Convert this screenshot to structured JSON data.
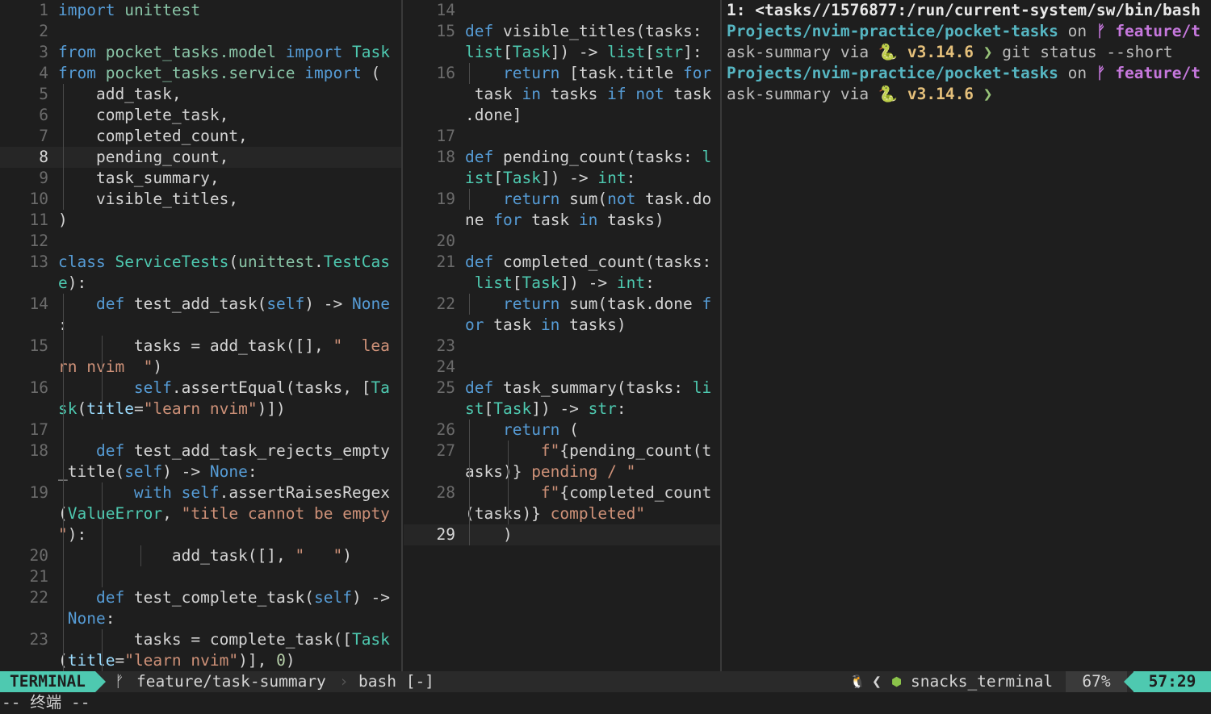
{
  "left_pane": {
    "lines": [
      {
        "n": "1",
        "code": [
          [
            "kw",
            "import"
          ],
          [
            "plain",
            " "
          ],
          [
            "mod",
            "unittest"
          ]
        ]
      },
      {
        "n": "2",
        "code": []
      },
      {
        "n": "3",
        "code": [
          [
            "kw",
            "from"
          ],
          [
            "plain",
            " "
          ],
          [
            "mod",
            "pocket_tasks.model"
          ],
          [
            "plain",
            " "
          ],
          [
            "kw",
            "import"
          ],
          [
            "plain",
            " "
          ],
          [
            "ty",
            "Task"
          ]
        ]
      },
      {
        "n": "4",
        "code": [
          [
            "kw",
            "from"
          ],
          [
            "plain",
            " "
          ],
          [
            "mod",
            "pocket_tasks.service"
          ],
          [
            "plain",
            " "
          ],
          [
            "kw",
            "import"
          ],
          [
            "plain",
            " ("
          ]
        ]
      },
      {
        "n": "5",
        "code": [
          [
            "plain",
            "    add_task,"
          ]
        ]
      },
      {
        "n": "6",
        "code": [
          [
            "plain",
            "    complete_task,"
          ]
        ]
      },
      {
        "n": "7",
        "code": [
          [
            "plain",
            "    completed_count,"
          ]
        ]
      },
      {
        "n": "8",
        "cur": true,
        "code": [
          [
            "plain",
            "    pending_count,"
          ]
        ]
      },
      {
        "n": "9",
        "code": [
          [
            "plain",
            "    task_summary,"
          ]
        ]
      },
      {
        "n": "10",
        "code": [
          [
            "plain",
            "    visible_titles,"
          ]
        ]
      },
      {
        "n": "11",
        "code": [
          [
            "plain",
            ")"
          ]
        ]
      },
      {
        "n": "12",
        "code": []
      },
      {
        "n": "13",
        "code": [
          [
            "kw",
            "class"
          ],
          [
            "plain",
            " "
          ],
          [
            "ty",
            "ServiceTests"
          ],
          [
            "plain",
            "("
          ],
          [
            "mod",
            "unittest"
          ],
          [
            "plain",
            "."
          ],
          [
            "ty",
            "TestCas"
          ]
        ]
      },
      {
        "n": "",
        "code": [
          [
            "ty",
            "e"
          ],
          [
            "plain",
            "):"
          ]
        ]
      },
      {
        "n": "14",
        "code": [
          [
            "plain",
            "    "
          ],
          [
            "kw",
            "def"
          ],
          [
            "plain",
            " test_add_task("
          ],
          [
            "slf",
            "self"
          ],
          [
            "plain",
            ") -> "
          ],
          [
            "kw",
            "None"
          ]
        ]
      },
      {
        "n": "",
        "code": [
          [
            "plain",
            ":"
          ]
        ]
      },
      {
        "n": "15",
        "code": [
          [
            "plain",
            "        tasks = add_task([], "
          ],
          [
            "str",
            "\"  lea"
          ]
        ]
      },
      {
        "n": "",
        "code": [
          [
            "str",
            "rn nvim  \""
          ],
          [
            "plain",
            ")"
          ]
        ]
      },
      {
        "n": "16",
        "code": [
          [
            "plain",
            "        "
          ],
          [
            "slf",
            "self"
          ],
          [
            "plain",
            ".assertEqual(tasks, ["
          ],
          [
            "ty",
            "Ta"
          ]
        ]
      },
      {
        "n": "",
        "code": [
          [
            "ty",
            "sk"
          ],
          [
            "plain",
            "("
          ],
          [
            "par",
            "title"
          ],
          [
            "plain",
            "="
          ],
          [
            "str",
            "\"learn nvim\""
          ],
          [
            "plain",
            ")])"
          ]
        ]
      },
      {
        "n": "17",
        "code": []
      },
      {
        "n": "18",
        "code": [
          [
            "plain",
            "    "
          ],
          [
            "kw",
            "def"
          ],
          [
            "plain",
            " test_add_task_rejects_empty"
          ]
        ]
      },
      {
        "n": "",
        "code": [
          [
            "plain",
            "_title("
          ],
          [
            "slf",
            "self"
          ],
          [
            "plain",
            ") -> "
          ],
          [
            "kw",
            "None"
          ],
          [
            "plain",
            ":"
          ]
        ]
      },
      {
        "n": "19",
        "code": [
          [
            "plain",
            "        "
          ],
          [
            "kw",
            "with"
          ],
          [
            "plain",
            " "
          ],
          [
            "slf",
            "self"
          ],
          [
            "plain",
            ".assertRaisesRegex"
          ]
        ]
      },
      {
        "n": "",
        "code": [
          [
            "plain",
            "("
          ],
          [
            "ty",
            "ValueError"
          ],
          [
            "plain",
            ", "
          ],
          [
            "str",
            "\"title cannot be empty"
          ]
        ]
      },
      {
        "n": "",
        "code": [
          [
            "str",
            "\""
          ],
          [
            "plain",
            "):"
          ]
        ]
      },
      {
        "n": "20",
        "code": [
          [
            "plain",
            "            add_task([], "
          ],
          [
            "str",
            "\"   \""
          ],
          [
            "plain",
            ")"
          ]
        ]
      },
      {
        "n": "21",
        "code": []
      },
      {
        "n": "22",
        "code": [
          [
            "plain",
            "    "
          ],
          [
            "kw",
            "def"
          ],
          [
            "plain",
            " test_complete_task("
          ],
          [
            "slf",
            "self"
          ],
          [
            "plain",
            ") ->"
          ]
        ]
      },
      {
        "n": "",
        "code": [
          [
            "plain",
            " "
          ],
          [
            "kw",
            "None"
          ],
          [
            "plain",
            ":"
          ]
        ]
      },
      {
        "n": "23",
        "code": [
          [
            "plain",
            "        tasks = complete_task(["
          ],
          [
            "ty",
            "Task"
          ]
        ]
      },
      {
        "n": "",
        "code": [
          [
            "plain",
            "("
          ],
          [
            "par",
            "title"
          ],
          [
            "plain",
            "="
          ],
          [
            "str",
            "\"learn nvim\""
          ],
          [
            "plain",
            ")], "
          ],
          [
            "num",
            "0"
          ],
          [
            "plain",
            ")"
          ]
        ]
      }
    ]
  },
  "mid_pane": {
    "lines": [
      {
        "n": "14",
        "code": []
      },
      {
        "n": "15",
        "code": [
          [
            "kw",
            "def"
          ],
          [
            "plain",
            " visible_titles(tasks:"
          ]
        ]
      },
      {
        "n": "",
        "code": [
          [
            "ty",
            "list"
          ],
          [
            "plain",
            "["
          ],
          [
            "ty",
            "Task"
          ],
          [
            "plain",
            "]) -> "
          ],
          [
            "ty",
            "list"
          ],
          [
            "plain",
            "["
          ],
          [
            "ty",
            "str"
          ],
          [
            "plain",
            "]:"
          ]
        ]
      },
      {
        "n": "16",
        "code": [
          [
            "plain",
            "    "
          ],
          [
            "kw",
            "return"
          ],
          [
            "plain",
            " [task.title "
          ],
          [
            "kw",
            "for"
          ]
        ]
      },
      {
        "n": "",
        "code": [
          [
            "plain",
            " task "
          ],
          [
            "kw",
            "in"
          ],
          [
            "plain",
            " tasks "
          ],
          [
            "kw",
            "if"
          ],
          [
            "plain",
            " "
          ],
          [
            "kw",
            "not"
          ],
          [
            "plain",
            " task"
          ]
        ]
      },
      {
        "n": "",
        "code": [
          [
            "plain",
            ".done]"
          ]
        ]
      },
      {
        "n": "17",
        "code": []
      },
      {
        "n": "18",
        "code": [
          [
            "kw",
            "def"
          ],
          [
            "plain",
            " pending_count(tasks: "
          ],
          [
            "ty",
            "l"
          ]
        ]
      },
      {
        "n": "",
        "code": [
          [
            "ty",
            "ist"
          ],
          [
            "plain",
            "["
          ],
          [
            "ty",
            "Task"
          ],
          [
            "plain",
            "]) -> "
          ],
          [
            "ty",
            "int"
          ],
          [
            "plain",
            ":"
          ]
        ]
      },
      {
        "n": "19",
        "code": [
          [
            "plain",
            "    "
          ],
          [
            "kw",
            "return"
          ],
          [
            "plain",
            " sum("
          ],
          [
            "kw",
            "not"
          ],
          [
            "plain",
            " task.do"
          ]
        ]
      },
      {
        "n": "",
        "code": [
          [
            "plain",
            "ne "
          ],
          [
            "kw",
            "for"
          ],
          [
            "plain",
            " task "
          ],
          [
            "kw",
            "in"
          ],
          [
            "plain",
            " tasks)"
          ]
        ]
      },
      {
        "n": "20",
        "code": []
      },
      {
        "n": "21",
        "code": [
          [
            "kw",
            "def"
          ],
          [
            "plain",
            " completed_count(tasks:"
          ]
        ]
      },
      {
        "n": "",
        "code": [
          [
            "plain",
            " "
          ],
          [
            "ty",
            "list"
          ],
          [
            "plain",
            "["
          ],
          [
            "ty",
            "Task"
          ],
          [
            "plain",
            "]) -> "
          ],
          [
            "ty",
            "int"
          ],
          [
            "plain",
            ":"
          ]
        ]
      },
      {
        "n": "22",
        "code": [
          [
            "plain",
            "    "
          ],
          [
            "kw",
            "return"
          ],
          [
            "plain",
            " sum(task.done "
          ],
          [
            "kw",
            "f"
          ]
        ]
      },
      {
        "n": "",
        "code": [
          [
            "kw",
            "or"
          ],
          [
            "plain",
            " task "
          ],
          [
            "kw",
            "in"
          ],
          [
            "plain",
            " tasks)"
          ]
        ]
      },
      {
        "n": "23",
        "code": []
      },
      {
        "n": "24",
        "code": []
      },
      {
        "n": "25",
        "code": [
          [
            "kw",
            "def"
          ],
          [
            "plain",
            " task_summary(tasks: "
          ],
          [
            "ty",
            "li"
          ]
        ]
      },
      {
        "n": "",
        "code": [
          [
            "ty",
            "st"
          ],
          [
            "plain",
            "["
          ],
          [
            "ty",
            "Task"
          ],
          [
            "plain",
            "]) -> "
          ],
          [
            "ty",
            "str"
          ],
          [
            "plain",
            ":"
          ]
        ]
      },
      {
        "n": "26",
        "code": [
          [
            "plain",
            "    "
          ],
          [
            "kw",
            "return"
          ],
          [
            "plain",
            " ("
          ]
        ]
      },
      {
        "n": "27",
        "code": [
          [
            "plain",
            "        "
          ],
          [
            "str",
            "f\""
          ],
          [
            "plain",
            "{pending_count(t"
          ]
        ]
      },
      {
        "n": "",
        "code": [
          [
            "plain",
            "asks)}"
          ],
          [
            "str",
            " pending / \""
          ]
        ]
      },
      {
        "n": "28",
        "code": [
          [
            "plain",
            "        "
          ],
          [
            "str",
            "f\""
          ],
          [
            "plain",
            "{completed_count"
          ]
        ]
      },
      {
        "n": "",
        "code": [
          [
            "plain",
            "(tasks)}"
          ],
          [
            "str",
            " completed\""
          ]
        ]
      },
      {
        "n": "29",
        "cur": true,
        "code": [
          [
            "plain",
            "    )"
          ]
        ]
      }
    ]
  },
  "terminal": {
    "lines": [
      [
        [
          "t-white",
          "1: <tasks//1576877:/run/current-system/sw/bin/bash"
        ]
      ],
      [
        [
          "t-cyan",
          "Projects/nvim-practice/pocket-tasks"
        ],
        [
          "t-gray",
          " on "
        ],
        [
          "t-pink",
          "ᚠ feature/t"
        ]
      ],
      [
        [
          "t-gray",
          "ask-summary via "
        ],
        [
          "t-yellow",
          "🐍 v3.14.6"
        ],
        [
          "t-green",
          " ❯"
        ],
        [
          "t-gray",
          " git status --short"
        ]
      ],
      [
        [
          "t-cyan",
          "Projects/nvim-practice/pocket-tasks"
        ],
        [
          "t-gray",
          " on "
        ],
        [
          "t-pink",
          "ᚠ feature/t"
        ]
      ],
      [
        [
          "t-gray",
          "ask-summary via "
        ],
        [
          "t-yellow",
          "🐍 v3.14.6"
        ],
        [
          "t-green",
          " ❯"
        ]
      ]
    ]
  },
  "statusline": {
    "mode": "TERMINAL",
    "branch_icon": "ᚠ",
    "branch": "feature/task-summary",
    "buffer": "bash [-]",
    "os_icon": "🐧",
    "filetype_icon": "⬢",
    "filetype": "snacks_terminal",
    "percent": "67%",
    "position": "57:29"
  },
  "cmdline": "-- 终端 --"
}
